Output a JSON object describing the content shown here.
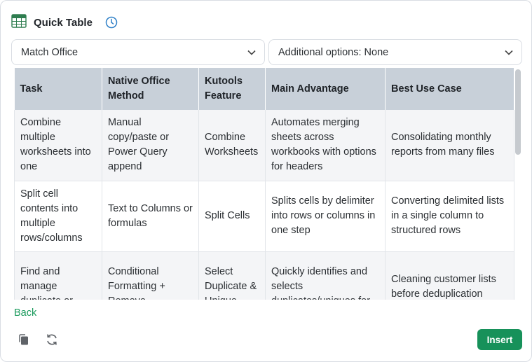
{
  "header": {
    "title": "Quick Table",
    "table_icon": "table-icon",
    "history_icon": "clock-icon"
  },
  "selects": {
    "style": {
      "value": "Match Office",
      "icon": "chevron-down-icon"
    },
    "options": {
      "value": "Additional options: None",
      "icon": "chevron-down-icon"
    }
  },
  "table": {
    "headers": [
      "Task",
      "Native Office Method",
      "Kutools Feature",
      "Main Advantage",
      "Best Use Case"
    ],
    "rows": [
      [
        "Combine multiple worksheets into one",
        "Manual copy/paste or Power Query append",
        "Combine Worksheets",
        "Automates merging sheets across workbooks with options for headers",
        "Consolidating monthly reports from many files"
      ],
      [
        "Split cell contents into multiple rows/columns",
        "Text to Columns or formulas",
        "Split Cells",
        "Splits cells by delimiter into rows or columns in one step",
        "Converting delimited lists in a single column to structured rows"
      ],
      [
        "Find and manage duplicate or",
        "Conditional Formatting + Remove",
        "Select Duplicate & Unique",
        "Quickly identifies and selects duplicates/uniques for",
        "Cleaning customer lists before deduplication"
      ]
    ]
  },
  "footer": {
    "back_label": "Back",
    "copy_icon": "copy-icon",
    "refresh_icon": "refresh-icon",
    "insert_label": "Insert"
  },
  "colors": {
    "accent": "#17915a",
    "link": "#1a9a5c",
    "header_bg": "#c8d0d9",
    "clock": "#2f80c8"
  }
}
